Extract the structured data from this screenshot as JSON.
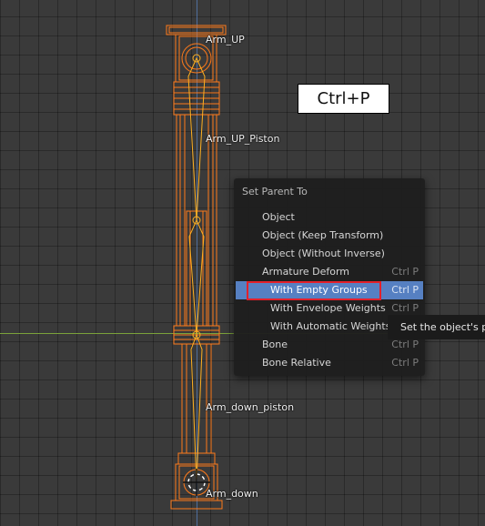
{
  "viewport": {
    "bones": [
      {
        "label": "Arm_UP"
      },
      {
        "label": "Arm_UP_Piston"
      },
      {
        "label": "Arm_down_piston"
      },
      {
        "label": "Arm_down"
      }
    ],
    "colors": {
      "wire": "#ff7a1a",
      "bone": "#ffb020",
      "axis_x": "#7ba23a",
      "axis_y": "#5a86c8"
    }
  },
  "overlay": {
    "shortcut_text": "Ctrl+P"
  },
  "menu": {
    "title": "Set Parent To",
    "items": [
      {
        "label": "Object",
        "shortcut": ""
      },
      {
        "label": "Object (Keep Transform)",
        "shortcut": ""
      },
      {
        "label": "Object (Without Inverse)",
        "shortcut": ""
      },
      {
        "label": "Armature Deform",
        "shortcut": "Ctrl P"
      },
      {
        "label": "With Empty Groups",
        "shortcut": "Ctrl P"
      },
      {
        "label": "With Envelope Weights",
        "shortcut": "Ctrl P"
      },
      {
        "label": "With Automatic Weights",
        "shortcut": ""
      },
      {
        "label": "Bone",
        "shortcut": "Ctrl P"
      },
      {
        "label": "Bone Relative",
        "shortcut": "Ctrl P"
      }
    ],
    "active_item": "With Empty Groups"
  },
  "tooltip": {
    "text": "Set the object's parenting"
  }
}
